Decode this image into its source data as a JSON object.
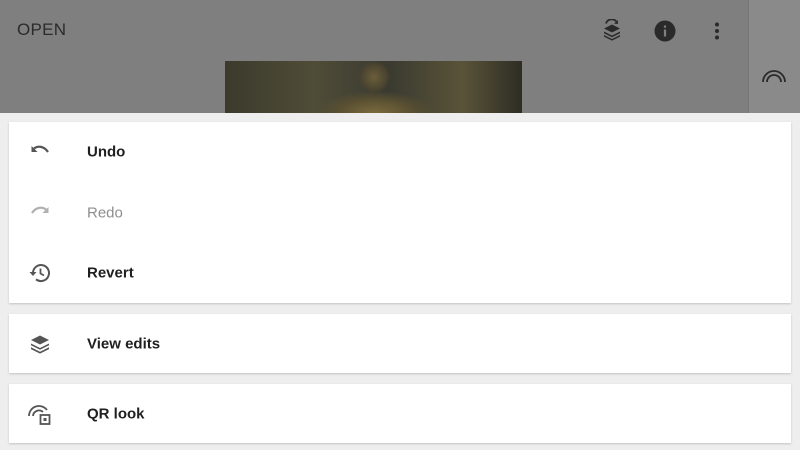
{
  "topbar": {
    "open_label": "OPEN",
    "icons": [
      "layers-history-icon",
      "info-icon",
      "more-vert-icon"
    ]
  },
  "rail": {
    "icon": "qr-look-icon"
  },
  "menu": {
    "group1": [
      {
        "label": "Undo",
        "icon": "undo-icon",
        "enabled": true
      },
      {
        "label": "Redo",
        "icon": "redo-icon",
        "enabled": false
      },
      {
        "label": "Revert",
        "icon": "revert-history-icon",
        "enabled": true
      }
    ],
    "group2": [
      {
        "label": "View edits",
        "icon": "layers-icon",
        "enabled": true
      }
    ],
    "group3": [
      {
        "label": "QR look",
        "icon": "qr-look-icon",
        "enabled": true
      }
    ]
  },
  "colors": {
    "scrim": "#7f7f7f",
    "sheet_bg": "#eeeeee",
    "card_bg": "#ffffff",
    "text_primary": "#1f1f1f",
    "text_disabled": "#8e8e8e",
    "icon": "#555555"
  }
}
